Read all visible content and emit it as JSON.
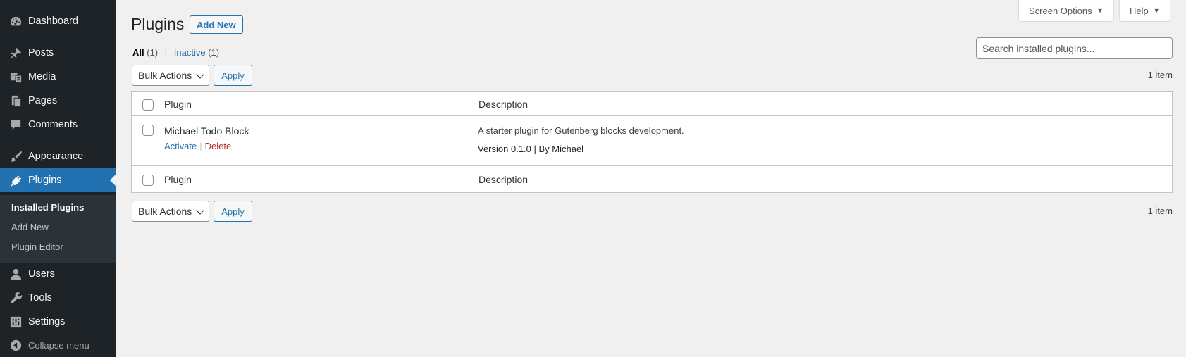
{
  "sidebar": {
    "items": [
      {
        "label": "Dashboard",
        "icon": "dashboard-icon"
      },
      {
        "label": "Posts",
        "icon": "pushpin-icon"
      },
      {
        "label": "Media",
        "icon": "media-icon"
      },
      {
        "label": "Pages",
        "icon": "pages-icon"
      },
      {
        "label": "Comments",
        "icon": "comment-icon"
      },
      {
        "label": "Appearance",
        "icon": "paintbrush-icon"
      },
      {
        "label": "Plugins",
        "icon": "plugin-icon"
      },
      {
        "label": "Users",
        "icon": "user-icon"
      },
      {
        "label": "Tools",
        "icon": "wrench-icon"
      },
      {
        "label": "Settings",
        "icon": "settings-icon"
      }
    ],
    "submenu": [
      {
        "label": "Installed Plugins"
      },
      {
        "label": "Add New"
      },
      {
        "label": "Plugin Editor"
      }
    ],
    "collapse_label": "Collapse menu"
  },
  "screen_meta": {
    "screen_options": "Screen Options",
    "help": "Help"
  },
  "header": {
    "title": "Plugins",
    "add_new": "Add New"
  },
  "filters": {
    "all_label": "All",
    "all_count": "(1)",
    "inactive_label": "Inactive",
    "inactive_count": "(1)"
  },
  "search": {
    "placeholder": "Search installed plugins..."
  },
  "tablenav": {
    "bulk_actions": "Bulk Actions",
    "apply": "Apply",
    "count": "1 item"
  },
  "table": {
    "columns": {
      "plugin": "Plugin",
      "description": "Description"
    },
    "rows": [
      {
        "name": "Michael Todo Block",
        "activate": "Activate",
        "delete": "Delete",
        "description": "A starter plugin for Gutenberg blocks development.",
        "meta": "Version 0.1.0 | By Michael"
      }
    ]
  },
  "colors": {
    "accent": "#2271b1",
    "sidebar_bg": "#1d2327",
    "delete": "#b32d2e"
  }
}
